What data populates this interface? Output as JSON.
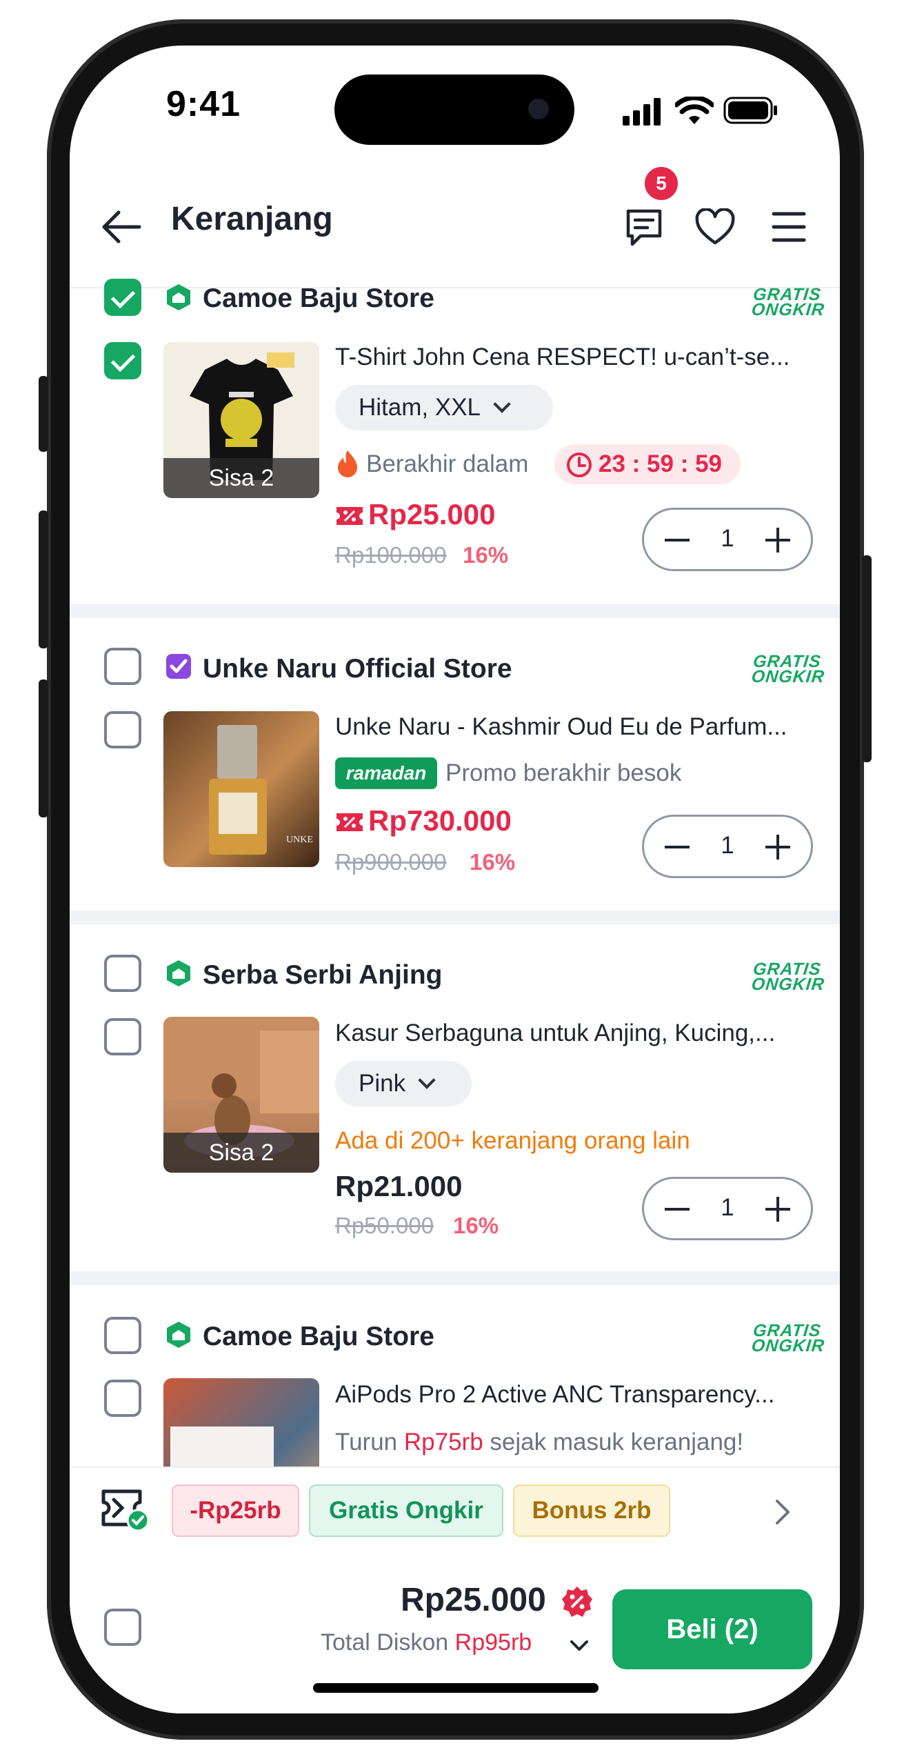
{
  "status": {
    "time": "9:41"
  },
  "header": {
    "title": "Keranjang",
    "chat_badge": "5"
  },
  "colors": {
    "accent": "#16a862",
    "danger": "#e4284a",
    "discount": "#f26178",
    "orange": "#f07b0a"
  },
  "shipping_badge": {
    "line1": "GRATIS",
    "line2": "ONGKIR"
  },
  "items": [
    {
      "store": "Camoe Baju Store",
      "store_checked": true,
      "item_checked": true,
      "store_badge_icon": "green-shop-badge-icon",
      "product": "T-Shirt John Cena RESPECT! u-can’t-se...",
      "variant": "Hitam, XXL",
      "stock_label": "Sisa 2",
      "urgency_label": "Berakhir dalam",
      "timer": "23 : 59 : 59",
      "price": "Rp25.000",
      "original_price": "Rp100.000",
      "discount": "16%",
      "qty": "1"
    },
    {
      "store": "Unke Naru Official Store",
      "store_checked": false,
      "item_checked": false,
      "store_badge_icon": "purple-official-badge-icon",
      "product": "Unke Naru - Kashmir Oud Eu de Parfum...",
      "promo_badge": "ramadan",
      "promo_text": "Promo berakhir besok",
      "price": "Rp730.000",
      "original_price": "Rp900.000",
      "discount": "16%",
      "qty": "1"
    },
    {
      "store": "Serba Serbi Anjing",
      "store_checked": false,
      "item_checked": false,
      "store_badge_icon": "green-shop-badge-icon",
      "product": "Kasur Serbaguna untuk Anjing, Kucing,...",
      "variant": "Pink",
      "stock_label": "Sisa 2",
      "social_text": "Ada di 200+ keranjang orang lain",
      "price": "Rp21.000",
      "original_price": "Rp50.000",
      "discount": "16%",
      "qty": "1"
    },
    {
      "store": "Camoe Baju Store",
      "store_checked": false,
      "item_checked": false,
      "store_badge_icon": "green-shop-badge-icon",
      "product": "AiPods Pro 2 Active ANC Transparency...",
      "price_drop_prefix": "Turun",
      "price_drop_amount": "Rp75rb",
      "price_drop_suffix": "sejak masuk keranjang!"
    }
  ],
  "promos": [
    {
      "label": "-Rp25rb",
      "bg": "#fde8ec",
      "border": "#f7c0ca",
      "color": "#d0243f"
    },
    {
      "label": "Gratis Ongkir",
      "bg": "#e3f7ee",
      "border": "#a9e3c6",
      "color": "#13935a"
    },
    {
      "label": "Bonus 2rb",
      "bg": "#fdf3d8",
      "border": "#f3dd9e",
      "color": "#a8700a"
    }
  ],
  "footer": {
    "total": "Rp25.000",
    "discount_label": "Total Diskon",
    "discount_value": "Rp95rb",
    "buy_label": "Beli (2)"
  }
}
